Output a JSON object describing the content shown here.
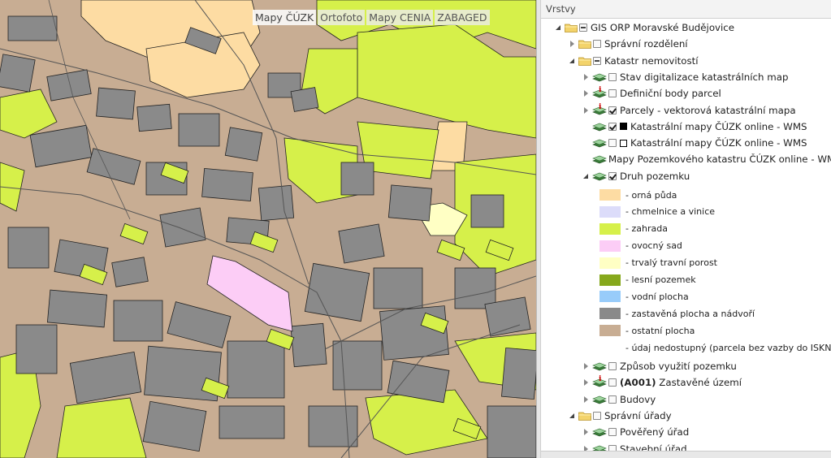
{
  "map": {
    "basemaps": [
      "Mapy ČÚZK",
      "Ortofoto",
      "Mapy CENIA",
      "ZABAGED"
    ],
    "active_basemap": "Mapy ČÚZK",
    "colors": {
      "road": "#c8ad93",
      "building": "#8a8a8a",
      "garden": "#d6f04a",
      "arable": "#fddca3",
      "orchard": "#fccdf6",
      "grassland": "#ffffc4",
      "outline": "#222222"
    }
  },
  "panel": {
    "title": "Vrstvy",
    "tree": [
      {
        "level": 0,
        "arrow": "expanded",
        "icon": "folder",
        "check": "partial",
        "label": "GIS ORP Moravské Budějovice"
      },
      {
        "level": 1,
        "arrow": "collapsed",
        "icon": "folder",
        "check": "unchecked",
        "label": "Správní rozdělení"
      },
      {
        "level": 1,
        "arrow": "expanded",
        "icon": "folder",
        "check": "partial",
        "label": "Katastr nemovitostí"
      },
      {
        "level": 2,
        "arrow": "collapsed",
        "icon": "layer",
        "check": "unchecked",
        "label": "Stav digitalizace katastrálních map"
      },
      {
        "level": 2,
        "arrow": "collapsed",
        "icon": "layer-info",
        "check": "unchecked",
        "label": "Definiční body parcel"
      },
      {
        "level": 2,
        "arrow": "collapsed",
        "icon": "layer-info",
        "check": "checked",
        "label": "Parcely - vektorová katastrální mapa"
      },
      {
        "level": 2,
        "arrow": "none",
        "icon": "layer",
        "check": "checked",
        "symbol": "filled",
        "label": "Katastrální mapy ČÚZK online - WMS"
      },
      {
        "level": 2,
        "arrow": "none",
        "icon": "layer",
        "check": "unchecked",
        "symbol": "empty",
        "label": "Katastrální mapy ČÚZK online - WMS"
      },
      {
        "level": 2,
        "arrow": "none",
        "icon": "layer",
        "check": "none",
        "label": "Mapy Pozemkového katastru ČÚZK online - WMS"
      },
      {
        "level": 2,
        "arrow": "expanded",
        "icon": "layer",
        "check": "checked",
        "label": "Druh pozemku"
      }
    ],
    "legend": [
      {
        "color": "#fddca3",
        "label": "- orná půda"
      },
      {
        "color": "#dcdcfa",
        "label": "- chmelnice a vinice"
      },
      {
        "color": "#d6f04a",
        "label": "- zahrada"
      },
      {
        "color": "#fccdf6",
        "label": "- ovocný sad"
      },
      {
        "color": "#ffffc4",
        "label": "- trvalý travní porost"
      },
      {
        "color": "#86a81c",
        "label": "- lesní pozemek"
      },
      {
        "color": "#98ccfa",
        "label": "- vodní plocha"
      },
      {
        "color": "#8a8a8a",
        "label": "- zastavěná plocha a nádvoří"
      },
      {
        "color": "#c8ad93",
        "label": "- ostatní plocha"
      },
      {
        "color": "",
        "label": "- údaj nedostupný (parcela bez vazby do ISKN)"
      }
    ],
    "tree_after": [
      {
        "level": 2,
        "arrow": "collapsed",
        "icon": "layer",
        "check": "unchecked",
        "label": "Způsob využití pozemku"
      },
      {
        "level": 2,
        "arrow": "collapsed",
        "icon": "layer-info",
        "check": "unchecked",
        "bold_prefix": "(A001)",
        "label": " Zastavěné území"
      },
      {
        "level": 2,
        "arrow": "collapsed",
        "icon": "layer",
        "check": "unchecked",
        "label": "Budovy"
      },
      {
        "level": 1,
        "arrow": "expanded",
        "icon": "folder",
        "check": "unchecked",
        "label": "Správní úřady"
      },
      {
        "level": 2,
        "arrow": "collapsed",
        "icon": "layer",
        "check": "unchecked",
        "label": "Pověřený úřad"
      },
      {
        "level": 2,
        "arrow": "collapsed",
        "icon": "layer",
        "check": "unchecked",
        "label": "Stavební úřad"
      }
    ]
  }
}
